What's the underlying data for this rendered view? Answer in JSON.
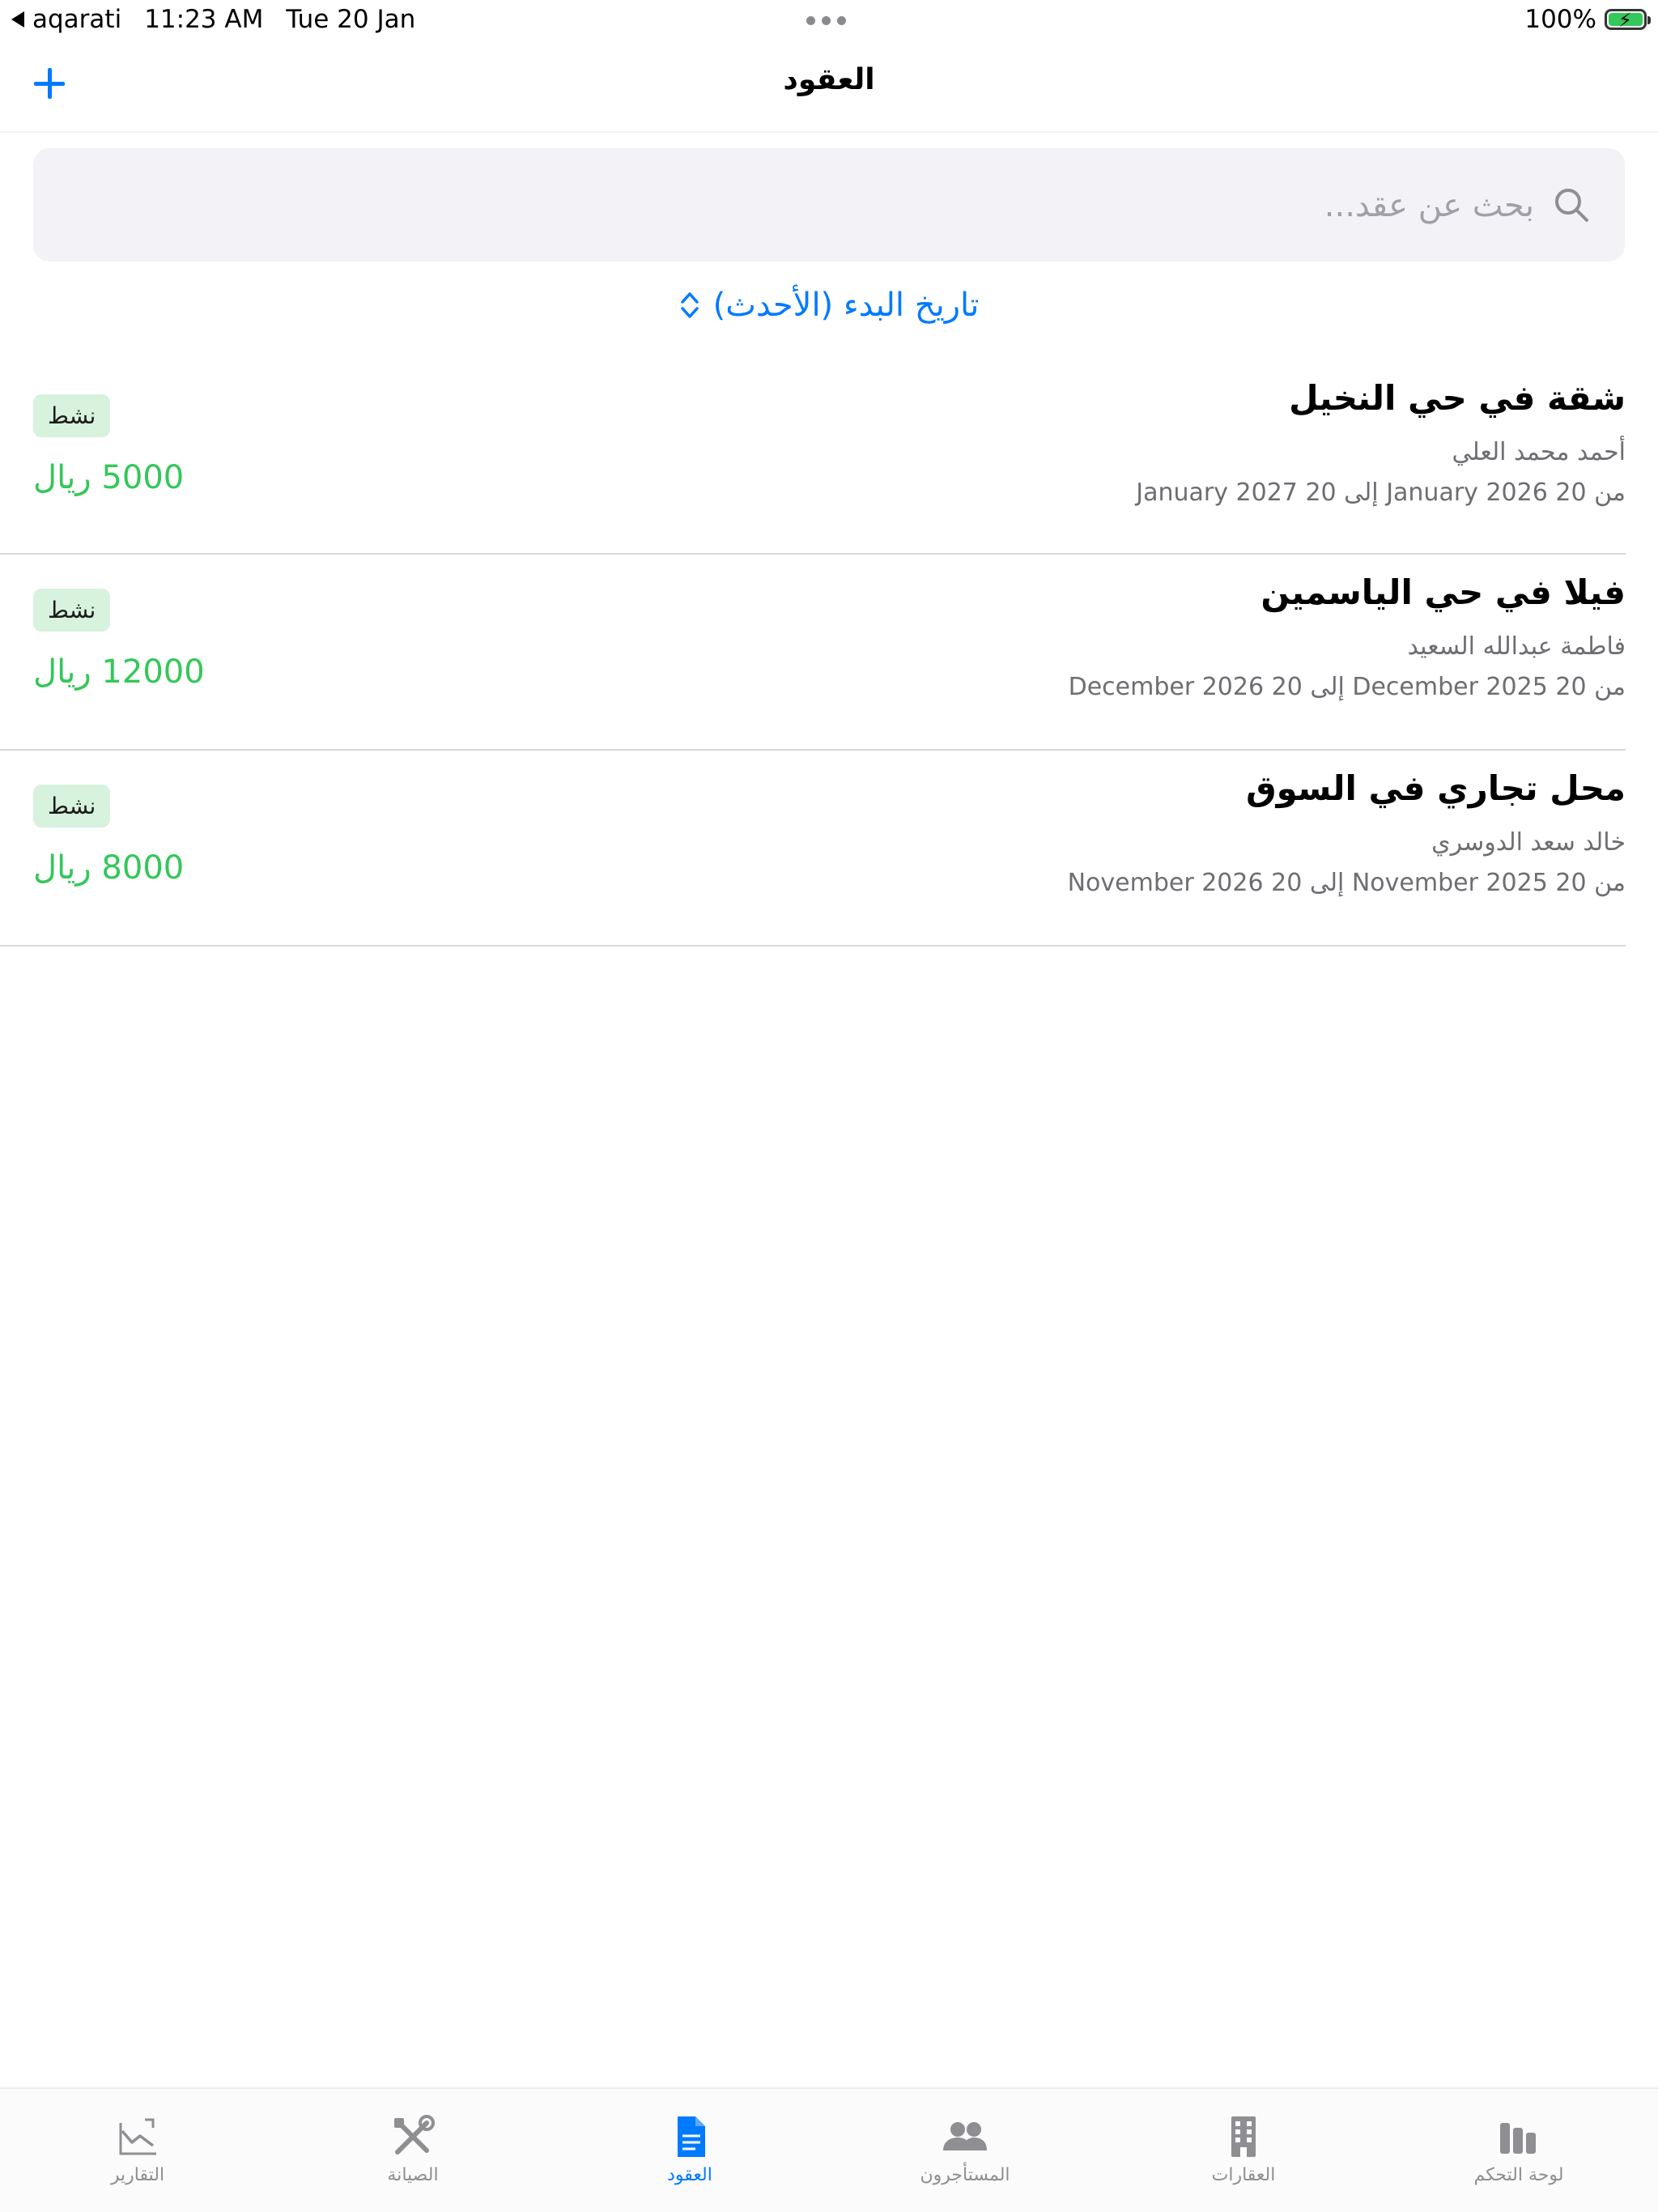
{
  "status_bar": {
    "back_app": "aqarati",
    "time": "11:23 AM",
    "date": "Tue 20 Jan",
    "battery": "100%"
  },
  "nav": {
    "title": "العقود",
    "add_icon": "plus-icon"
  },
  "search": {
    "placeholder": "بحث عن عقد...",
    "value": ""
  },
  "sort": {
    "label": "تاريخ البدء (الأحدث)"
  },
  "contracts": [
    {
      "title": "شقة في حي النخيل",
      "tenant": "أحمد محمد العلي",
      "dates": "من 20 January 2026 إلى 20 January 2027",
      "status": "نشط",
      "amount": "5000 ريال"
    },
    {
      "title": "فيلا في حي الياسمين",
      "tenant": "فاطمة عبدالله السعيد",
      "dates": "من 20 December 2025 إلى 20 December 2026",
      "status": "نشط",
      "amount": "12000 ريال"
    },
    {
      "title": "محل تجاري في السوق",
      "tenant": "خالد سعد الدوسري",
      "dates": "من 20 November 2025 إلى 20 November 2026",
      "status": "نشط",
      "amount": "8000 ريال"
    }
  ],
  "tabs": [
    {
      "label": "التقارير",
      "icon": "chart-icon",
      "active": false
    },
    {
      "label": "الصيانة",
      "icon": "tools-icon",
      "active": false
    },
    {
      "label": "العقود",
      "icon": "document-icon",
      "active": true
    },
    {
      "label": "المستأجرون",
      "icon": "people-icon",
      "active": false
    },
    {
      "label": "العقارات",
      "icon": "building-icon",
      "active": false
    },
    {
      "label": "لوحة التحكم",
      "icon": "dashboard-icon",
      "active": false
    }
  ],
  "colors": {
    "accent": "#007aff",
    "success": "#34c759",
    "badge_bg": "#d7f2dd"
  }
}
